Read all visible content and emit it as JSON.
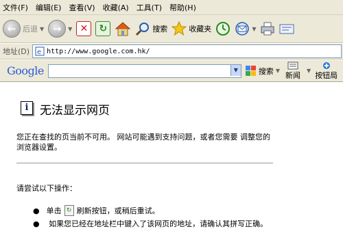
{
  "menu": [
    "文件(F)",
    "编辑(E)",
    "查看(V)",
    "收藏(A)",
    "工具(T)",
    "帮助(H)"
  ],
  "toolbar": {
    "back_label": "后退",
    "search_label": "搜索",
    "favorites_label": "收藏夹"
  },
  "address": {
    "label": "地址(D)",
    "url": "http://www.google.com.hk/"
  },
  "googlebar": {
    "logo": "Google",
    "search_label": "搜索",
    "new_label": "新闻",
    "button_label": "按钮局"
  },
  "error_page": {
    "title": "无法显示网页",
    "description": "您正在查找的页当前不可用。 网站可能遇到支持问题，或者您需要 调整您的浏览器设置。",
    "try_label": "请尝试以下操作：",
    "item1_prefix": "单击",
    "item1_suffix": "刷新按钮，或稍后重试。",
    "item2": "如果您已经在地址栏中键入了该网页的地址，请确认其拼写正确。"
  }
}
